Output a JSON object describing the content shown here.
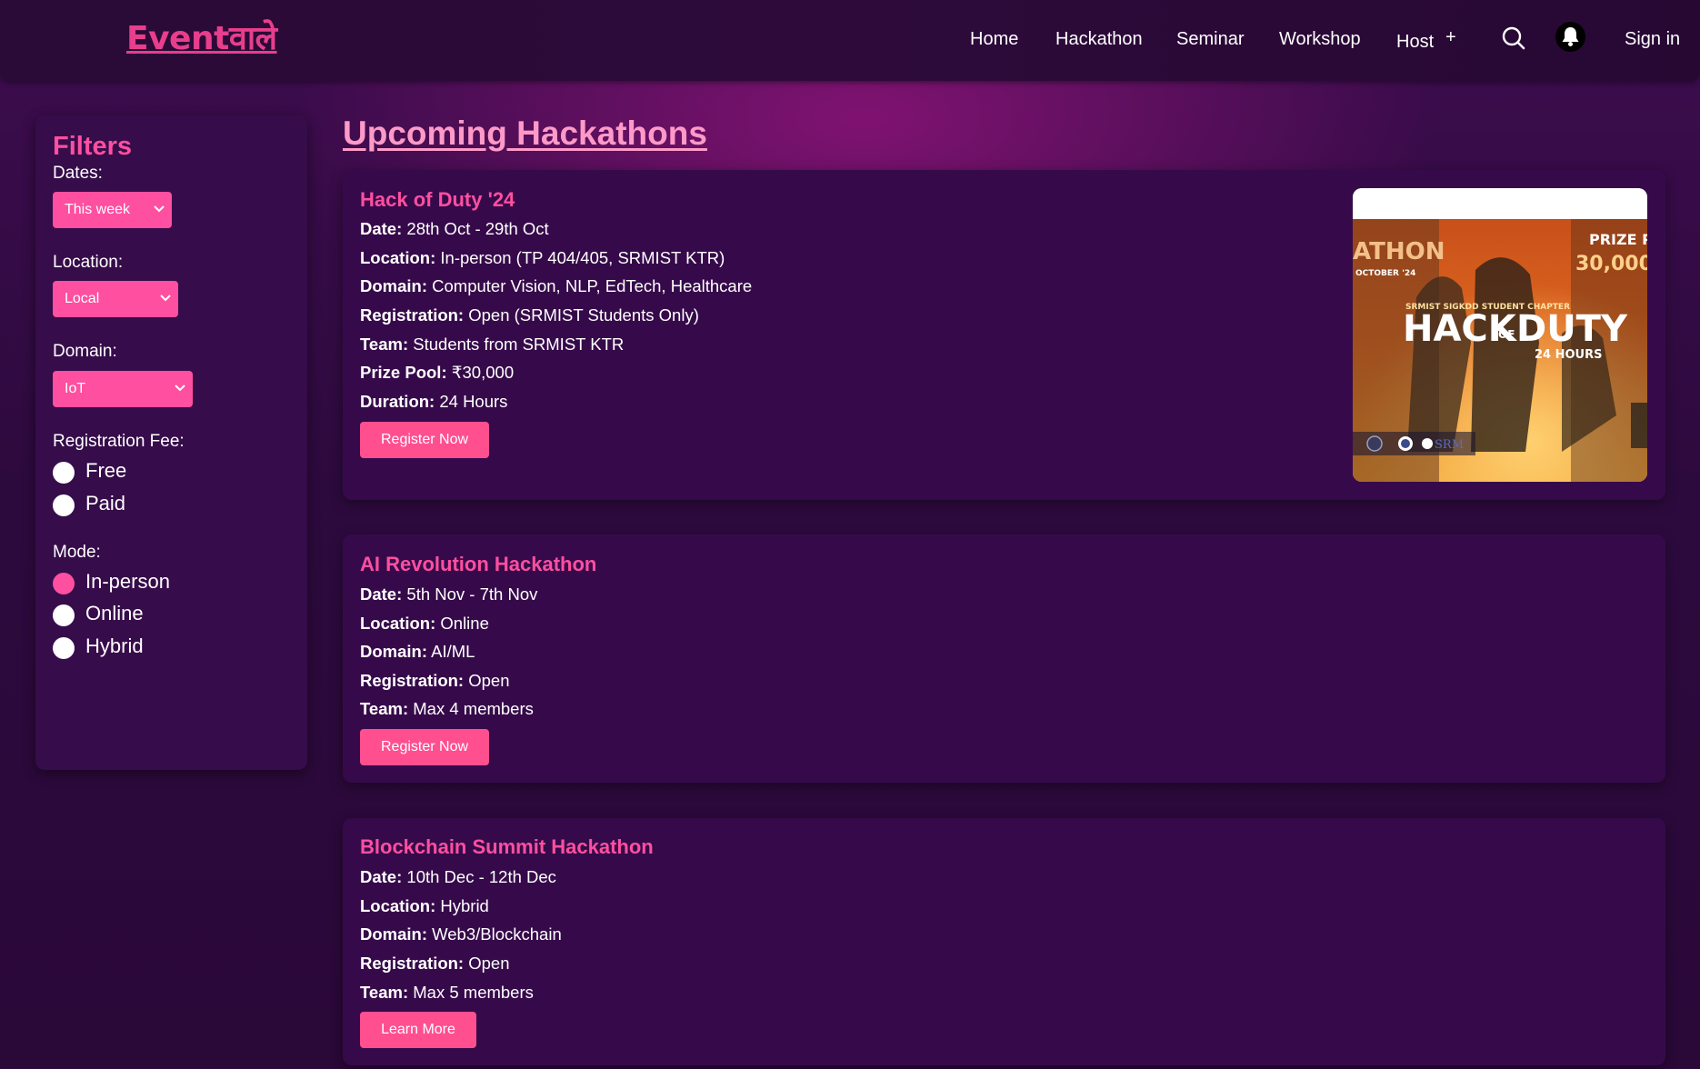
{
  "brand": {
    "logo_text": "Eventवाले"
  },
  "nav": {
    "items": [
      "Home",
      "Hackathon",
      "Seminar",
      "Workshop",
      "Host"
    ],
    "host_plus": "+",
    "search_icon": "search-icon",
    "bell_icon": "bell-icon",
    "sign_in": "Sign in"
  },
  "filters": {
    "title": "Filters",
    "dates_label": "Dates:",
    "dates_value": "This week",
    "location_label": "Location:",
    "location_value": "Local",
    "domain_label": "Domain:",
    "domain_value": "IoT",
    "fee_label": "Registration Fee:",
    "fee_options": [
      "Free",
      "Paid"
    ],
    "mode_label": "Mode:",
    "mode_options": [
      "In-person",
      "Online",
      "Hybrid"
    ],
    "mode_selected": "In-person"
  },
  "main": {
    "title": "Upcoming Hackathons"
  },
  "events": [
    {
      "title": "Hack of Duty '24",
      "details": [
        {
          "label": "Date:",
          "value": "28th Oct - 29th Oct"
        },
        {
          "label": "Location:",
          "value": "In-person (TP 404/405, SRMIST KTR)"
        },
        {
          "label": "Domain:",
          "value": "Computer Vision, NLP, EdTech, Healthcare"
        },
        {
          "label": "Registration:",
          "value": "Open (SRMIST Students Only)"
        },
        {
          "label": "Team:",
          "value": "Students from SRMIST KTR"
        },
        {
          "label": "Prize Pool:",
          "value": "₹30,000"
        },
        {
          "label": "Duration:",
          "value": "24 Hours"
        }
      ],
      "button": "Register Now",
      "poster": {
        "top_left": "ATHON",
        "month": "OCTOBER '24",
        "prize_label": "PRIZE P",
        "prize_value": "30,000",
        "chapter": "SRMIST SIGKDD STUDENT CHAPTER",
        "main_title": "HACK",
        "of": "OF",
        "duty": "DUTY",
        "hours": "24 HOURS",
        "srm": "SRM"
      }
    },
    {
      "title": "AI Revolution Hackathon",
      "details": [
        {
          "label": "Date:",
          "value": "5th Nov - 7th Nov"
        },
        {
          "label": "Location:",
          "value": "Online"
        },
        {
          "label": "Domain:",
          "value": "AI/ML"
        },
        {
          "label": "Registration:",
          "value": "Open"
        },
        {
          "label": "Team:",
          "value": "Max 4 members"
        }
      ],
      "button": "Register Now"
    },
    {
      "title": "Blockchain Summit Hackathon",
      "details": [
        {
          "label": "Date:",
          "value": "10th Dec - 12th Dec"
        },
        {
          "label": "Location:",
          "value": "Hybrid"
        },
        {
          "label": "Domain:",
          "value": "Web3/Blockchain"
        },
        {
          "label": "Registration:",
          "value": "Open"
        },
        {
          "label": "Team:",
          "value": "Max 5 members"
        }
      ],
      "button": "Learn More"
    }
  ]
}
